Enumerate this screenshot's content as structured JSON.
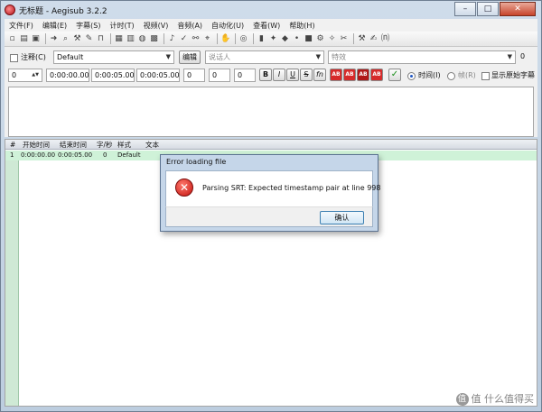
{
  "window": {
    "title": "无标题 - Aegisub 3.2.2",
    "minimize": "–",
    "maximize": "□",
    "close": "✕"
  },
  "menu": [
    "文件(F)",
    "编辑(E)",
    "字幕(S)",
    "计时(T)",
    "视频(V)",
    "音频(A)",
    "自动化(U)",
    "查看(W)",
    "帮助(H)"
  ],
  "toolbar": {
    "icons": [
      {
        "name": "new-file-icon",
        "glyph": "▫"
      },
      {
        "name": "open-file-icon",
        "glyph": "▤"
      },
      {
        "name": "save-icon",
        "glyph": "▣"
      },
      {
        "name": "sep"
      },
      {
        "name": "jump-icon",
        "glyph": "➜"
      },
      {
        "name": "zoom-icon",
        "glyph": "⌕"
      },
      {
        "name": "wrench-icon",
        "glyph": "⚒"
      },
      {
        "name": "tool-icon",
        "glyph": "✎"
      },
      {
        "name": "lock-icon",
        "glyph": "⊓"
      },
      {
        "name": "sep"
      },
      {
        "name": "properties-icon",
        "glyph": "▦"
      },
      {
        "name": "attachments-icon",
        "glyph": "▥"
      },
      {
        "name": "fonts-icon",
        "glyph": "◍"
      },
      {
        "name": "styles-icon",
        "glyph": "▩"
      },
      {
        "name": "sep"
      },
      {
        "name": "translate-icon",
        "glyph": "♪"
      },
      {
        "name": "spellcheck-icon",
        "glyph": "✓"
      },
      {
        "name": "resample-icon",
        "glyph": "⚯"
      },
      {
        "name": "timing-icon",
        "glyph": "⌖"
      },
      {
        "name": "sep"
      },
      {
        "name": "automation-icon",
        "glyph": "✋"
      },
      {
        "name": "sep"
      },
      {
        "name": "options-icon",
        "glyph": "◎"
      },
      {
        "name": "sep"
      },
      {
        "name": "video-icon",
        "glyph": "▮"
      },
      {
        "name": "shift-icon",
        "glyph": "✦"
      },
      {
        "name": "snap-icon",
        "glyph": "◆"
      },
      {
        "name": "play-icon",
        "glyph": "•"
      },
      {
        "name": "stop-icon",
        "glyph": "■"
      },
      {
        "name": "kanji-icon",
        "glyph": "⚙"
      },
      {
        "name": "visual-icon",
        "glyph": "✧"
      },
      {
        "name": "select-icon",
        "glyph": "✂"
      },
      {
        "name": "sep"
      },
      {
        "name": "hammer-icon",
        "glyph": "⚒"
      },
      {
        "name": "brush-icon",
        "glyph": "✍"
      },
      {
        "name": "script-icon",
        "glyph": "⒩"
      }
    ]
  },
  "edit": {
    "comment_label": "注释(C)",
    "style_value": "Default",
    "edit_button": "编辑",
    "actor_placeholder": "说话人",
    "effect_placeholder": "特效",
    "margin_vert": "0",
    "layer": "0",
    "start_time": "0:00:00.00",
    "end_time": "0:00:05.00",
    "duration": "0:00:05.00",
    "margin_l": "0",
    "margin_r": "0",
    "margin_v": "0",
    "bold": "B",
    "italic": "I",
    "underline": "U",
    "strike": "S",
    "font": "fn",
    "ab": "AB",
    "commit": "✓",
    "time_label": "时间(I)",
    "frame_label": "帧(R)",
    "show_original_label": "显示原始字幕",
    "ab_colors": [
      "#d62a2a",
      "#d62a2a",
      "#b01818",
      "#d62a2a"
    ]
  },
  "grid": {
    "headers": [
      "#",
      "开始时间",
      "结束时间",
      "字/秒",
      "样式",
      "文本"
    ],
    "rows": [
      {
        "num": "1",
        "start": "0:00:00.00",
        "end": "0:00:05.00",
        "cps": "0",
        "style": "Default",
        "text": ""
      }
    ]
  },
  "dialog": {
    "title": "Error loading file",
    "icon": "✕",
    "message": "Parsing SRT: Expected timestamp pair at line 998",
    "ok": "确认"
  },
  "watermark": {
    "text": "值 什么值得买",
    "circle": "值"
  }
}
